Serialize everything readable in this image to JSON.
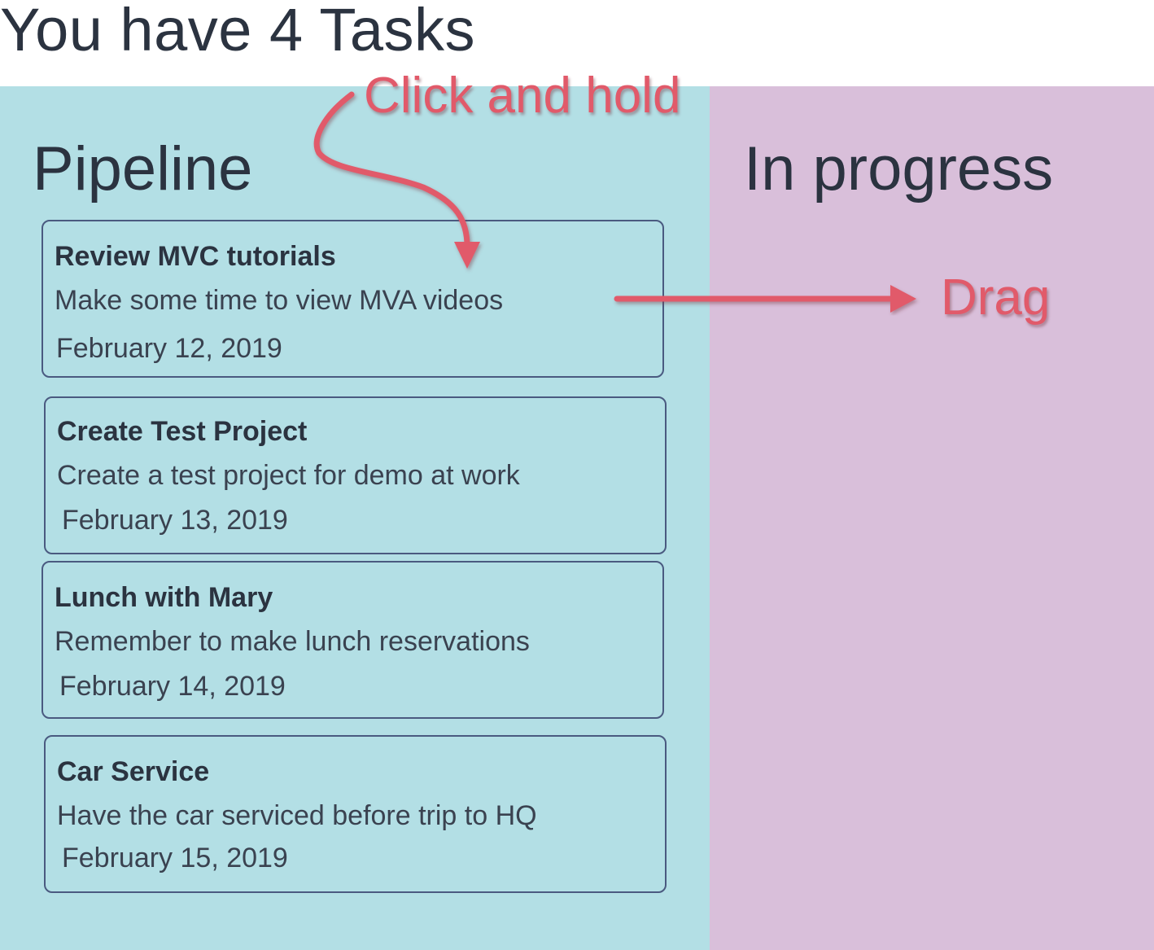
{
  "header": {
    "title": "You have 4 Tasks"
  },
  "columns": {
    "pipeline": {
      "title": "Pipeline"
    },
    "in_progress": {
      "title": "In progress"
    }
  },
  "tasks": [
    {
      "title": "Review MVC tutorials",
      "description": "Make some time to view MVA videos",
      "date": "February 12, 2019"
    },
    {
      "title": "Create Test Project",
      "description": "Create a test project for demo at work",
      "date": "February 13, 2019"
    },
    {
      "title": "Lunch with Mary",
      "description": "Remember to make lunch reservations",
      "date": "February 14, 2019"
    },
    {
      "title": "Car Service",
      "description": "Have the car serviced before trip to HQ",
      "date": "February 15, 2019"
    }
  ],
  "annotations": {
    "click_and_hold": "Click and hold",
    "drag": "Drag"
  },
  "colors": {
    "pipeline_background": "#b3dfe5",
    "in_progress_background": "#d9bfda",
    "card_border": "#4a5a80",
    "annotation": "#e15a6a",
    "text": "#2b3340"
  }
}
